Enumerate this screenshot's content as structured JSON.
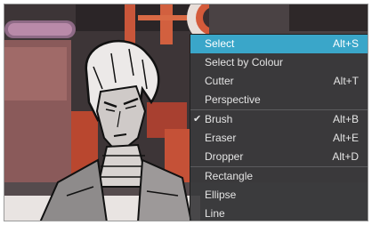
{
  "menu": {
    "items": [
      {
        "label": "Select",
        "shortcut": "Alt+S",
        "highlighted": true,
        "checked": false
      },
      {
        "label": "Select by Colour",
        "shortcut": "",
        "highlighted": false,
        "checked": false
      },
      {
        "label": "Cutter",
        "shortcut": "Alt+T",
        "highlighted": false,
        "checked": false
      },
      {
        "label": "Perspective",
        "shortcut": "",
        "highlighted": false,
        "checked": false
      },
      {
        "label": "Brush",
        "shortcut": "Alt+B",
        "highlighted": false,
        "checked": true
      },
      {
        "label": "Eraser",
        "shortcut": "Alt+E",
        "highlighted": false,
        "checked": false
      },
      {
        "label": "Dropper",
        "shortcut": "Alt+D",
        "highlighted": false,
        "checked": false
      },
      {
        "label": "Rectangle",
        "shortcut": "",
        "highlighted": false,
        "checked": false
      },
      {
        "label": "Ellipse",
        "shortcut": "",
        "highlighted": false,
        "checked": false
      },
      {
        "label": "Line",
        "shortcut": "",
        "highlighted": false,
        "checked": false
      }
    ],
    "check_mark": "✔"
  },
  "colors": {
    "highlight": "#3aa6c9",
    "menu_bg": "#3a3a3c",
    "menu_text": "#e4e4e4"
  }
}
